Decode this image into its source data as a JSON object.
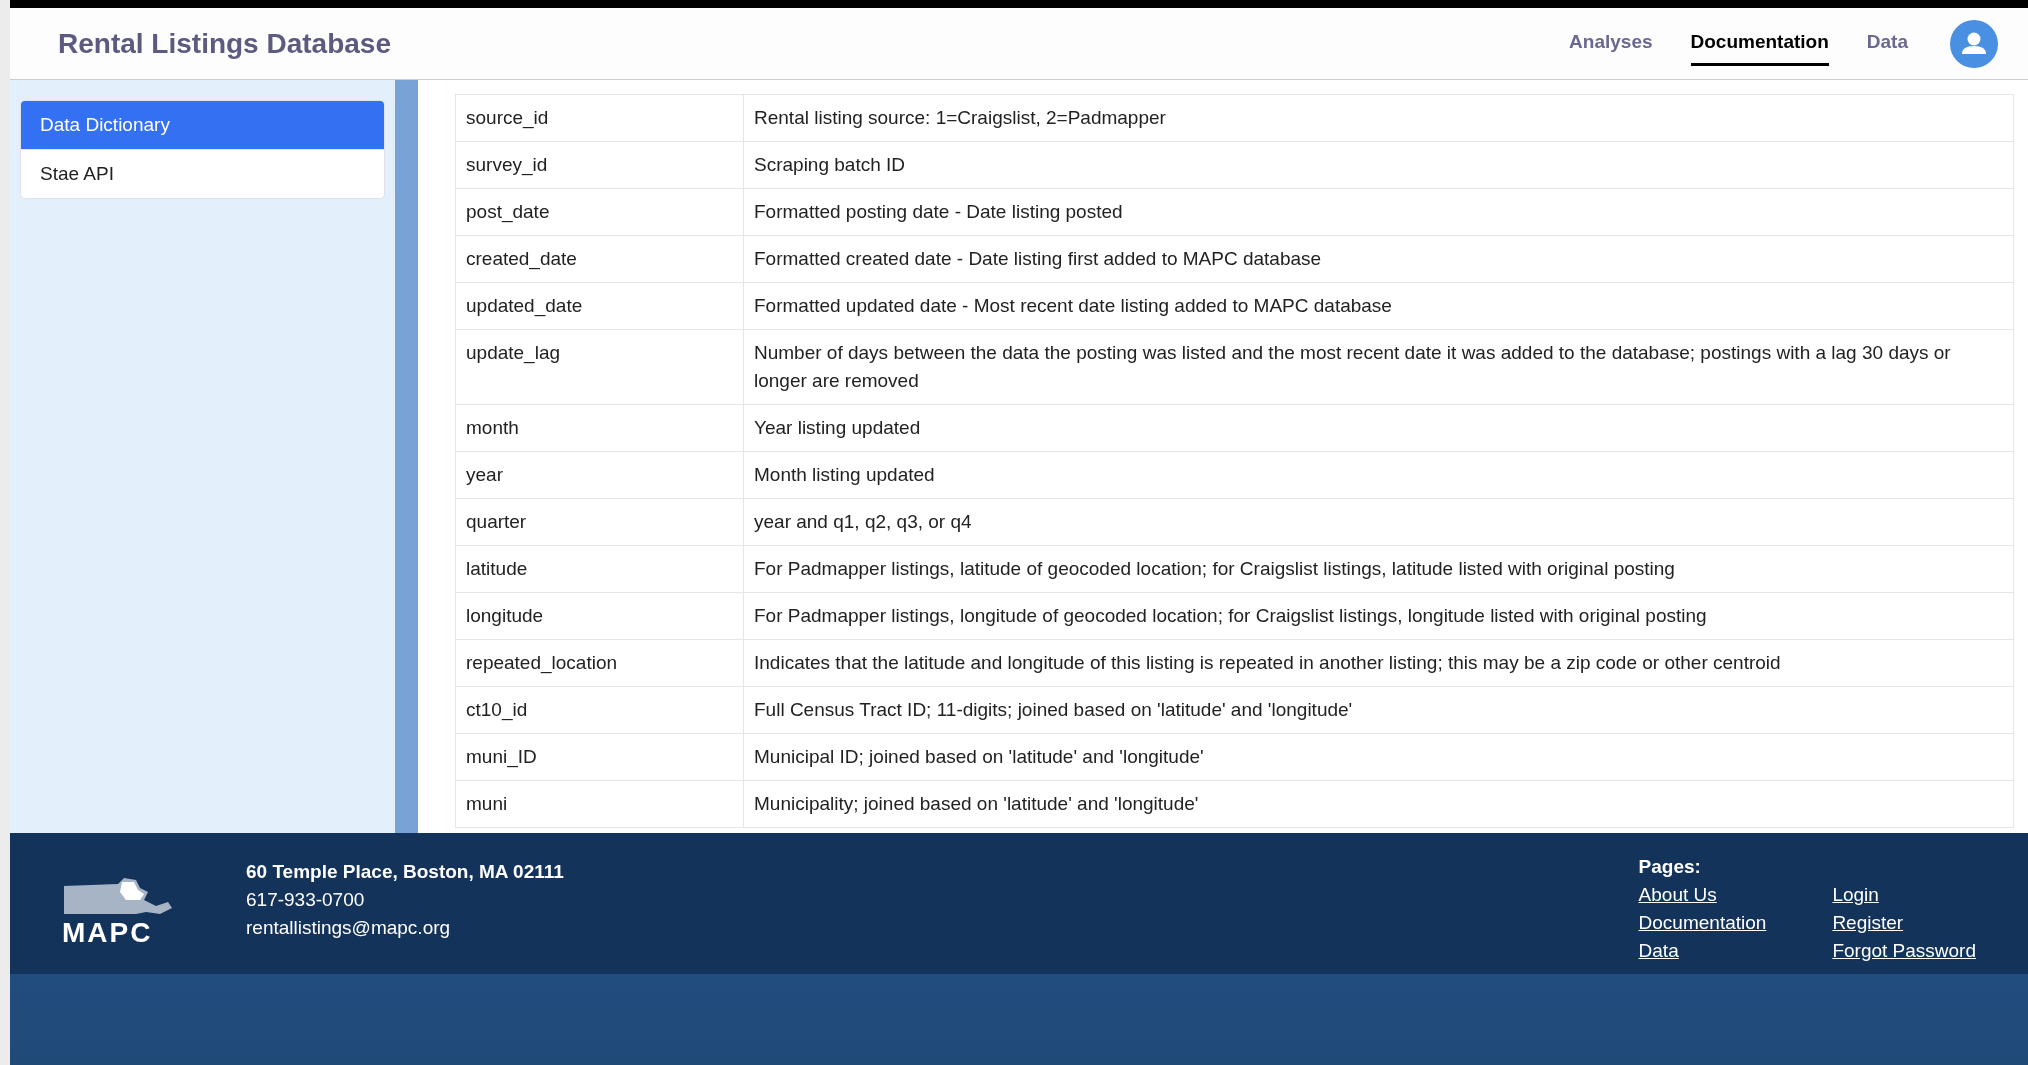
{
  "header": {
    "title": "Rental Listings Database",
    "nav": [
      {
        "label": "Analyses",
        "selected": false
      },
      {
        "label": "Documentation",
        "selected": true
      },
      {
        "label": "Data",
        "selected": false
      }
    ]
  },
  "sidebar": {
    "items": [
      {
        "label": "Data Dictionary",
        "selected": true
      },
      {
        "label": "Stae API",
        "selected": false
      }
    ]
  },
  "table": {
    "rows": [
      {
        "field": "source_id",
        "description": "Rental listing source: 1=Craigslist, 2=Padmapper"
      },
      {
        "field": "survey_id",
        "description": "Scraping batch ID"
      },
      {
        "field": "post_date",
        "description": "Formatted posting date - Date listing posted"
      },
      {
        "field": "created_date",
        "description": "Formatted created date - Date listing first added to MAPC database"
      },
      {
        "field": "updated_date",
        "description": "Formatted updated date - Most recent date listing added to MAPC database"
      },
      {
        "field": "update_lag",
        "description": "Number of days between the data the posting was listed and the most recent date it was added to the database; postings with a lag 30 days or longer are removed"
      },
      {
        "field": "month",
        "description": "Year listing updated"
      },
      {
        "field": "year",
        "description": "Month listing updated"
      },
      {
        "field": "quarter",
        "description": "year and q1, q2, q3, or q4"
      },
      {
        "field": "latitude",
        "description": "For Padmapper listings, latitude of geocoded location; for Craigslist listings, latitude listed with original posting"
      },
      {
        "field": "longitude",
        "description": "For Padmapper listings, longitude of geocoded location; for Craigslist listings, longitude listed with original posting"
      },
      {
        "field": "repeated_location",
        "description": "Indicates that the latitude and longitude of this listing is repeated in another listing; this may be a zip code or other centroid"
      },
      {
        "field": "ct10_id",
        "description": "Full Census Tract ID; 11-digits; joined based on 'latitude' and 'longitude'"
      },
      {
        "field": "muni_ID",
        "description": "Municipal ID; joined based on 'latitude' and 'longitude'"
      },
      {
        "field": "muni",
        "description": "Municipality; joined based on 'latitude' and 'longitude'"
      }
    ]
  },
  "footer": {
    "logo_text": "MAPC",
    "address": "60 Temple Place, Boston, MA 02111",
    "phone": "617-933-0700",
    "email": "rentallistings@mapc.org",
    "pages_heading": "Pages:",
    "links": [
      [
        "About Us",
        "Documentation",
        "Data"
      ],
      [
        "Login",
        "Register",
        "Forgot Password"
      ]
    ]
  }
}
